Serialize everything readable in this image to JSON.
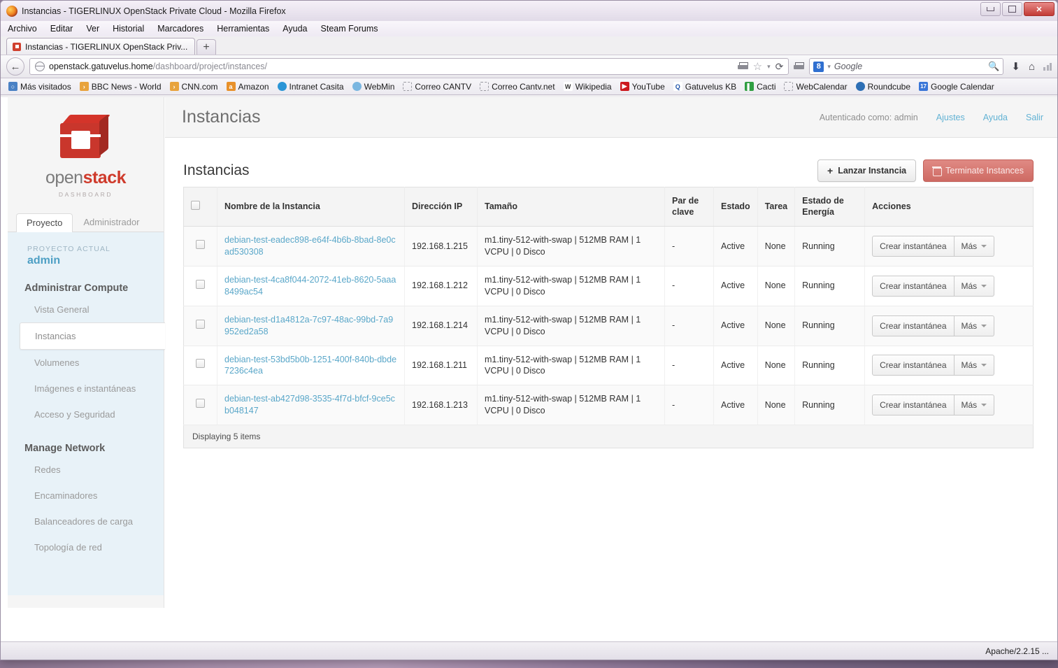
{
  "window": {
    "title": "Instancias - TIGERLINUX OpenStack Private Cloud - Mozilla Firefox",
    "minimize": "–",
    "maximize": "❐",
    "close": "✕"
  },
  "menubar": [
    "Archivo",
    "Editar",
    "Ver",
    "Historial",
    "Marcadores",
    "Herramientas",
    "Ayuda",
    "Steam Forums"
  ],
  "tabs": {
    "active_tab": "Instancias - TIGERLINUX OpenStack Priv...",
    "new_tab": "+"
  },
  "navbar": {
    "back": "←",
    "url_scheme_host": "openstack.gatuvelus.home",
    "url_path": "/dashboard/project/instances/",
    "reload": "⟳",
    "star": "☆",
    "dropdown": "▾",
    "print": "🖶",
    "search_engine": "8",
    "search_placeholder": "Google",
    "search_icon": "search-icon",
    "download_icon": "⬇",
    "home_icon": "⌂"
  },
  "bookmarks": [
    {
      "label": "Más visitados",
      "color": "#4a81c4",
      "glyph": "🔍"
    },
    {
      "label": "BBC News - World",
      "color": "#e8a33d",
      "glyph": "≫"
    },
    {
      "label": "CNN.com",
      "color": "#e8a33d",
      "glyph": "≫"
    },
    {
      "label": "Amazon",
      "color": "#e8912b",
      "glyph": "a"
    },
    {
      "label": "Intranet Casita",
      "color": "#2b95d6",
      "glyph": "💧"
    },
    {
      "label": "WebMin",
      "color": "#7ab6e0",
      "glyph": "✿"
    },
    {
      "label": "Correo CANTV",
      "color": "",
      "glyph": ""
    },
    {
      "label": "Correo Cantv.net",
      "color": "",
      "glyph": ""
    },
    {
      "label": "Wikipedia",
      "color": "#ffffff",
      "glyph": "W"
    },
    {
      "label": "YouTube",
      "color": "#cc181e",
      "glyph": "▶"
    },
    {
      "label": "Gatuvelus KB",
      "color": "#ffffff",
      "glyph": "Q"
    },
    {
      "label": "Cacti",
      "color": "#2f9e41",
      "glyph": "▌"
    },
    {
      "label": "WebCalendar",
      "color": "",
      "glyph": ""
    },
    {
      "label": "Roundcube",
      "color": "#2d6fb5",
      "glyph": "◉"
    },
    {
      "label": "Google Calendar",
      "color": "#3a76d8",
      "glyph": "17"
    }
  ],
  "sidebar": {
    "brand_open": "open",
    "brand_stack": "stack",
    "brand_sub": "DASHBOARD",
    "tabs": [
      {
        "label": "Proyecto",
        "active": true
      },
      {
        "label": "Administrador",
        "active": false
      }
    ],
    "current_project_label": "PROYECTO ACTUAL",
    "current_project_value": "admin",
    "groups": [
      {
        "heading": "Administrar Compute",
        "items": [
          {
            "label": "Vista General",
            "active": false
          },
          {
            "label": "Instancias",
            "active": true
          },
          {
            "label": "Volumenes",
            "active": false
          },
          {
            "label": "Imágenes e instantáneas",
            "active": false
          },
          {
            "label": "Acceso y Seguridad",
            "active": false
          }
        ]
      },
      {
        "heading": "Manage Network",
        "items": [
          {
            "label": "Redes",
            "active": false
          },
          {
            "label": "Encaminadores",
            "active": false
          },
          {
            "label": "Balanceadores de carga",
            "active": false
          },
          {
            "label": "Topología de red",
            "active": false
          }
        ]
      }
    ]
  },
  "topbar": {
    "page_title": "Instancias",
    "auth_as": "Autenticado como: admin",
    "links": [
      "Ajustes",
      "Ayuda",
      "Salir"
    ]
  },
  "panel": {
    "title": "Instancias",
    "launch_button": "Lanzar Instancia",
    "launch_icon": "+",
    "terminate_button": "Terminate Instances",
    "terminate_icon": "trash-icon",
    "footer": "Displaying 5 items"
  },
  "table": {
    "columns": [
      "",
      "Nombre de la Instancia",
      "Dirección IP",
      "Tamaño",
      "Par de clave",
      "Estado",
      "Tarea",
      "Estado de Energía",
      "Acciones"
    ],
    "action_primary": "Crear instantánea",
    "action_more": "Más",
    "rows": [
      {
        "name": "debian-test-eadec898-e64f-4b6b-8bad-8e0cad530308",
        "ip": "192.168.1.215",
        "size": "m1.tiny-512-with-swap | 512MB RAM | 1 VCPU | 0 Disco",
        "keypair": "-",
        "status": "Active",
        "task": "None",
        "power": "Running"
      },
      {
        "name": "debian-test-4ca8f044-2072-41eb-8620-5aaa8499ac54",
        "ip": "192.168.1.212",
        "size": "m1.tiny-512-with-swap | 512MB RAM | 1 VCPU | 0 Disco",
        "keypair": "-",
        "status": "Active",
        "task": "None",
        "power": "Running"
      },
      {
        "name": "debian-test-d1a4812a-7c97-48ac-99bd-7a9952ed2a58",
        "ip": "192.168.1.214",
        "size": "m1.tiny-512-with-swap | 512MB RAM | 1 VCPU | 0 Disco",
        "keypair": "-",
        "status": "Active",
        "task": "None",
        "power": "Running"
      },
      {
        "name": "debian-test-53bd5b0b-1251-400f-840b-dbde7236c4ea",
        "ip": "192.168.1.211",
        "size": "m1.tiny-512-with-swap | 512MB RAM | 1 VCPU | 0 Disco",
        "keypair": "-",
        "status": "Active",
        "task": "None",
        "power": "Running"
      },
      {
        "name": "debian-test-ab427d98-3535-4f7d-bfcf-9ce5cb048147",
        "ip": "192.168.1.213",
        "size": "m1.tiny-512-with-swap | 512MB RAM | 1 VCPU | 0 Disco",
        "keypair": "-",
        "status": "Active",
        "task": "None",
        "power": "Running"
      }
    ]
  },
  "statusbar": {
    "text": "Apache/2.2.15 ..."
  },
  "colors": {
    "accent_link": "#5aa7c9",
    "brand_red": "#cf3b2c",
    "sidebar_panel": "#e8f2f8",
    "danger": "#ce6a63"
  }
}
